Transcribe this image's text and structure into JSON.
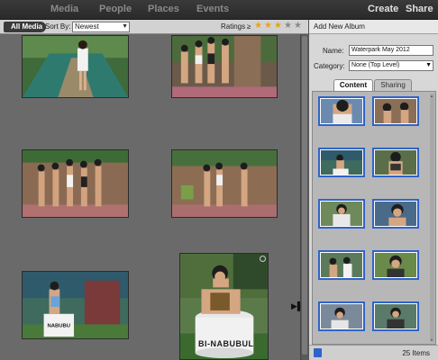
{
  "nav": {
    "items": [
      {
        "label": "Media"
      },
      {
        "label": "People"
      },
      {
        "label": "Places"
      },
      {
        "label": "Events"
      }
    ],
    "create_label": "Create",
    "share_label": "Share"
  },
  "filterbar": {
    "all_media_label": "All Media",
    "sort_label": "Sort By:",
    "sort_value": "Newest",
    "ratings_label": "Ratings",
    "ratings_operator": "≥",
    "ratings_stars_filled": 3,
    "ratings_stars_total": 5
  },
  "grid": {
    "thumbnails": [
      {
        "caption": ""
      },
      {
        "caption": ""
      },
      {
        "caption": ""
      },
      {
        "caption": ""
      },
      {
        "caption": ""
      },
      {
        "caption": "BI-NABUBUL"
      }
    ]
  },
  "panel": {
    "title": "Add New Album",
    "name_label": "Name:",
    "name_value": "Waterpark May 2012",
    "category_label": "Category:",
    "category_value": "None (Top Level)",
    "tabs": [
      {
        "label": "Content",
        "active": true
      },
      {
        "label": "Sharing",
        "active": false
      }
    ],
    "item_count_label": "25 Items"
  },
  "colors": {
    "accent": "#2f63c9",
    "star": "#e8a21c"
  }
}
